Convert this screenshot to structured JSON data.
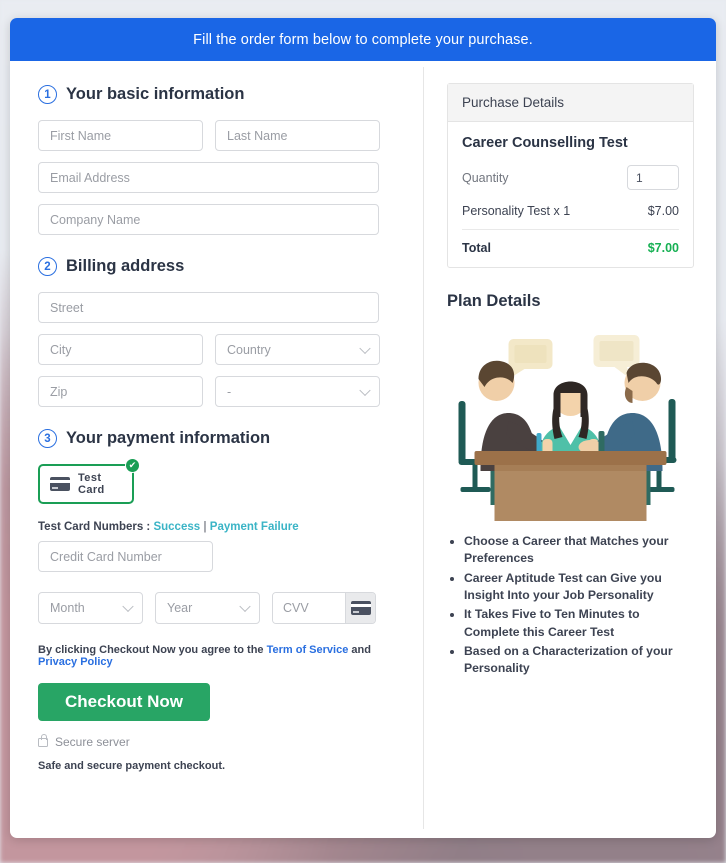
{
  "banner": {
    "text": "Fill the order form below to complete your purchase."
  },
  "sections": {
    "basic": {
      "number": "1",
      "title": "Your basic information",
      "fields": {
        "first_name": "First Name",
        "last_name": "Last Name",
        "email": "Email Address",
        "company": "Company Name"
      }
    },
    "billing": {
      "number": "2",
      "title": "Billing address",
      "fields": {
        "street": "Street",
        "city": "City",
        "country": "Country",
        "zip": "Zip",
        "state": "-"
      }
    },
    "payment": {
      "number": "3",
      "title": "Your payment information",
      "card_option_label": "Test Card",
      "card_option_icon": "credit-card-icon",
      "card_option_badge": "✔",
      "test_numbers_label": "Test Card Numbers :",
      "test_success_link": "Success",
      "test_separator": "|",
      "test_failure_link": "Payment Failure",
      "card_number": "Credit Card Number",
      "month": "Month",
      "year": "Year",
      "cvv": "CVV",
      "cvv_icon": "credit-card-icon"
    }
  },
  "footer": {
    "terms_prefix": "By clicking Checkout Now you agree to the ",
    "terms_link": "Term of Service",
    "terms_middle": " and ",
    "privacy_link": "Privacy Policy",
    "checkout_label": "Checkout Now",
    "secure_icon": "lock-icon",
    "secure_label": "Secure server",
    "safe_note": "Safe and secure payment checkout."
  },
  "purchase": {
    "header": "Purchase Details",
    "product": "Career Counselling Test",
    "quantity_label": "Quantity",
    "quantity_value": "1",
    "line_item_label": "Personality Test x 1",
    "line_item_price": "$7.00",
    "total_label": "Total",
    "total_price": "$7.00"
  },
  "plan": {
    "header": "Plan Details",
    "illustration": "three-people-meeting-illustration",
    "bullets": [
      "Choose a Career that Matches your Preferences",
      "Career Aptitude Test can Give you Insight Into your Job Personality",
      "It Takes Five to Ten Minutes to Complete this Career Test",
      "Based on a Characterization of your Personality"
    ]
  },
  "colors": {
    "banner_blue": "#1a66e6",
    "accent_green": "#28a565",
    "total_green": "#16b053",
    "link_blue": "#2a6fe0",
    "link_teal": "#3ab4c6",
    "card_border_green": "#1a9e55"
  }
}
